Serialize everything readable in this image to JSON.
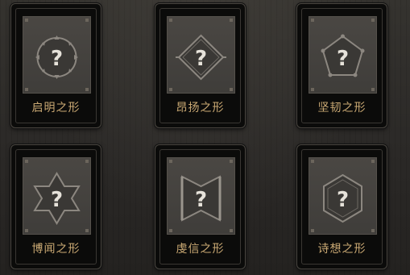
{
  "cards": [
    {
      "label": "启明之形",
      "emblem": "circle-question-icon"
    },
    {
      "label": "昂扬之形",
      "emblem": "diamond-question-icon"
    },
    {
      "label": "坚韧之形",
      "emblem": "pentagon-question-icon"
    },
    {
      "label": "博闻之形",
      "emblem": "hexagram-question-icon"
    },
    {
      "label": "虔信之形",
      "emblem": "bowtie-question-icon"
    },
    {
      "label": "诗想之形",
      "emblem": "hexagon-question-icon"
    }
  ],
  "colors": {
    "label": "#c9a873",
    "emblem_stroke": "#8c8780",
    "question_mark": "#e6e2da"
  }
}
